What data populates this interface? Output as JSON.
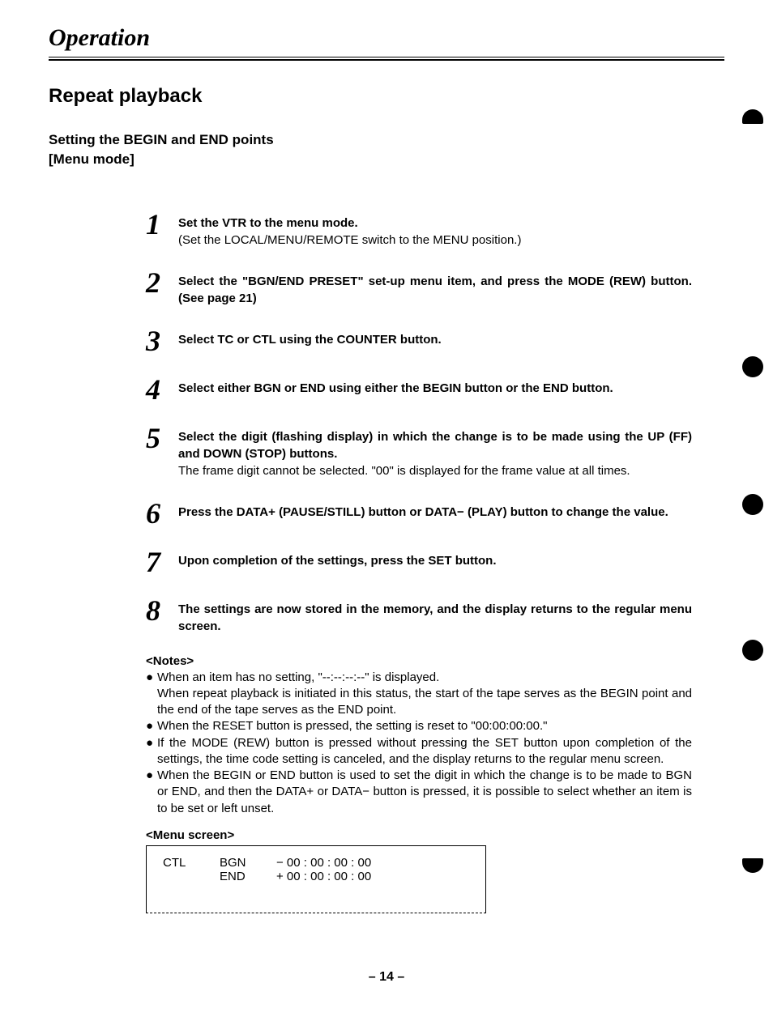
{
  "section_title": "Operation",
  "subsection_title": "Repeat playback",
  "subsubsection_line1": "Setting the BEGIN and END points",
  "subsubsection_line2": "[Menu mode]",
  "steps": [
    {
      "num": "1",
      "bold": "Set the VTR to the menu mode.",
      "plain": "(Set the LOCAL/MENU/REMOTE switch to the MENU position.)"
    },
    {
      "num": "2",
      "bold": "Select the \"BGN/END PRESET\" set-up menu item, and press the MODE (REW) button. (See page 21)",
      "plain": ""
    },
    {
      "num": "3",
      "bold": "Select TC or CTL using the COUNTER button.",
      "plain": ""
    },
    {
      "num": "4",
      "bold": "Select either BGN or END using either the BEGIN button or the END button.",
      "plain": ""
    },
    {
      "num": "5",
      "bold": "Select the digit (flashing display) in which the change is to be made using the UP (FF) and DOWN (STOP) buttons.",
      "plain": "The frame digit cannot be selected. \"00\" is displayed for the frame value at all times."
    },
    {
      "num": "6",
      "bold": "Press the DATA+ (PAUSE/STILL) button or DATA− (PLAY) button to change the value.",
      "plain": ""
    },
    {
      "num": "7",
      "bold": "Upon completion of the settings, press the SET button.",
      "plain": ""
    },
    {
      "num": "8",
      "bold": "The settings are now stored in the memory, and the display returns to the regular menu screen.",
      "plain": ""
    }
  ],
  "notes_heading": "<Notes>",
  "notes": [
    {
      "line1": "When an item has no setting, \"--:--:--:--\" is displayed.",
      "line2": "When repeat playback is initiated in this status, the start of the tape serves as the BEGIN point and the end of the tape serves as the END point."
    },
    {
      "line1": "When the RESET button is pressed, the setting is reset to \"00:00:00:00.\"",
      "line2": ""
    },
    {
      "line1": "If the MODE (REW) button is pressed without pressing the SET button upon completion of the settings, the time code setting is canceled, and the display returns to the regular menu screen.",
      "line2": ""
    },
    {
      "line1": "When the BEGIN or END button is used to set the digit in which the change is to be made to BGN or END, and then the DATA+ or DATA− button is pressed, it is possible to select whether an item is to be set or left unset.",
      "line2": ""
    }
  ],
  "menu_heading": "<Menu screen>",
  "menu_row1": {
    "c1": "CTL",
    "c2": "BGN",
    "c3": "− 00 : 00 : 00 : 00"
  },
  "menu_row2": {
    "c1": "",
    "c2": "END",
    "c3": "+ 00 : 00 : 00 : 00"
  },
  "page_number": "– 14 –"
}
